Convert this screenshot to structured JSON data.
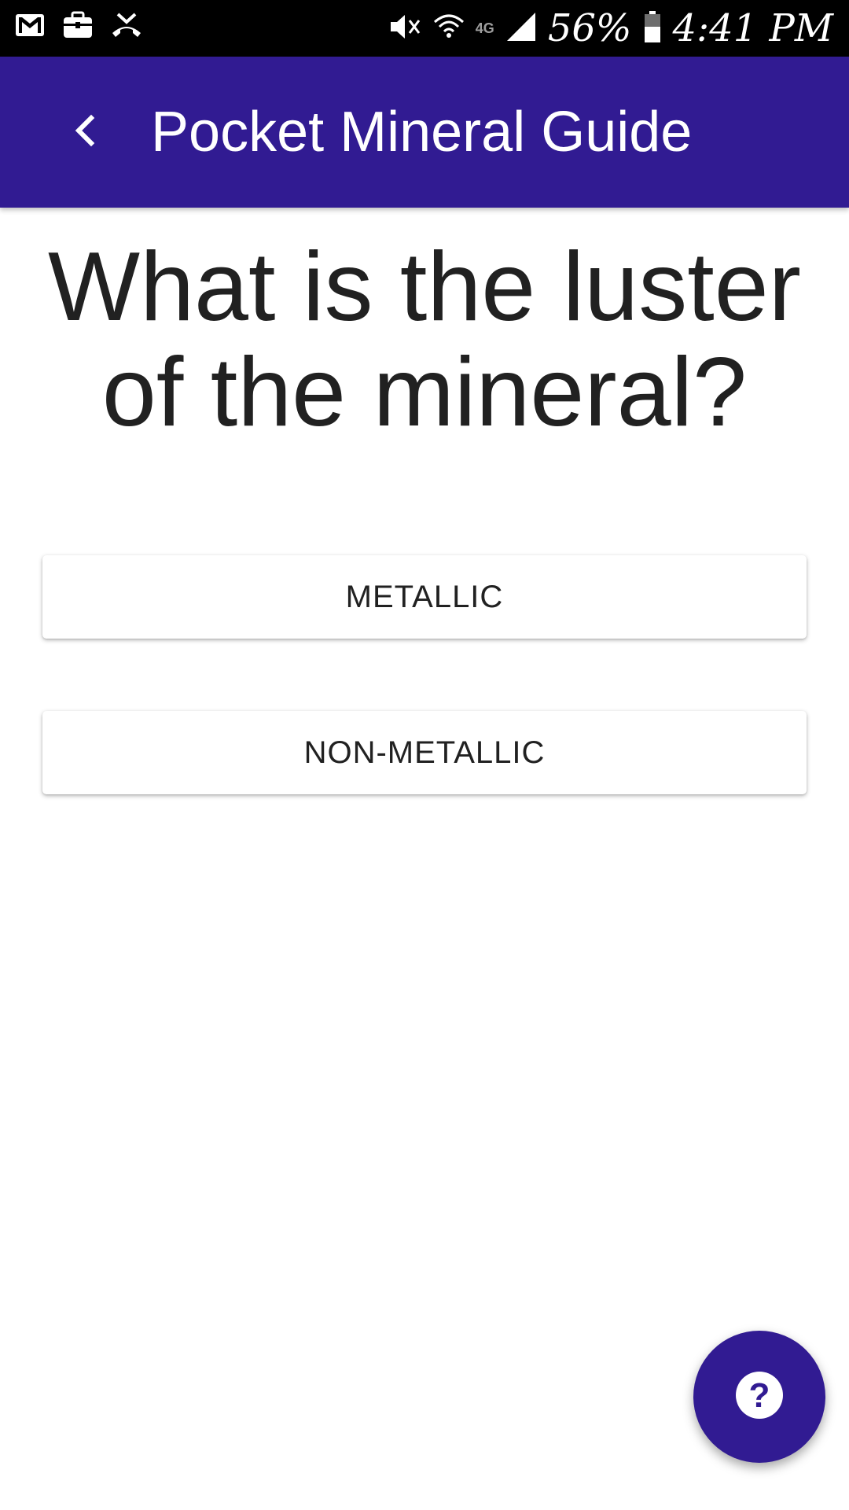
{
  "theme": {
    "primary_color": "#311b92",
    "text_color": "#212121"
  },
  "status_bar": {
    "left_icons": [
      "gmail-icon",
      "briefcase-icon",
      "missed-call-icon"
    ],
    "right_icons": [
      "mute-icon",
      "wifi-icon",
      "lte-icon",
      "signal-icon",
      "battery-icon"
    ],
    "network_label": "4G",
    "battery_percent": "56%",
    "time": "4:41 PM"
  },
  "app_bar": {
    "back_icon": "chevron-left-icon",
    "title": "Pocket Mineral Guide"
  },
  "question": {
    "text": "What is the luster of the mineral?"
  },
  "answers": [
    {
      "label": "METALLIC"
    },
    {
      "label": "NON-METALLIC"
    }
  ],
  "fab": {
    "icon": "help-icon",
    "glyph": "?"
  }
}
